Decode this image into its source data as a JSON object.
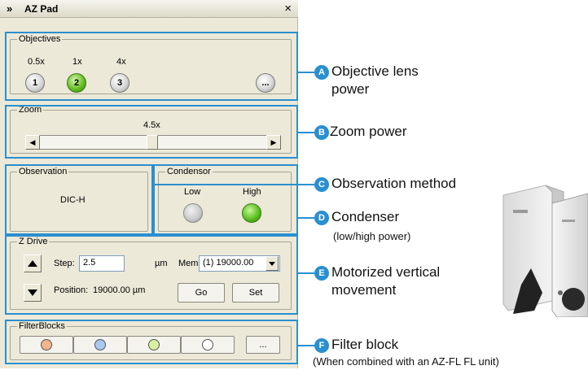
{
  "titlebar": {
    "chevron": "»",
    "title": "AZ Pad",
    "close": "×"
  },
  "objectives": {
    "legend": "Objectives",
    "magnifications": [
      "0.5x",
      "1x",
      "4x"
    ],
    "buttons": [
      "1",
      "2",
      "3"
    ],
    "active_button": "2",
    "more": "..."
  },
  "zoom": {
    "legend": "Zoom",
    "value": "4.5x",
    "left_arrow": "◀",
    "right_arrow": "▶"
  },
  "observation": {
    "legend": "Observation",
    "value": "DIC-H"
  },
  "condensor": {
    "legend": "Condensor",
    "low_label": "Low",
    "high_label": "High",
    "active": "High"
  },
  "z_drive": {
    "legend": "Z Drive",
    "step_label": "Step:",
    "step_value": "2.5",
    "step_unit": "µm",
    "mem_label": "Mem:",
    "mem_value": "(1) 19000.00",
    "position_label": "Position:",
    "position_value": "19000.00 µm",
    "go_label": "Go",
    "set_label": "Set"
  },
  "filterblocks": {
    "legend": "FilterBlocks",
    "colors": [
      "#f4b48c",
      "#a8c8f0",
      "#d8f0a0",
      "#ffffff"
    ],
    "more": "..."
  },
  "callouts": [
    {
      "badge": "A",
      "line1": "Objective lens",
      "line2": "power"
    },
    {
      "badge": "B",
      "line1": "Zoom power"
    },
    {
      "badge": "C",
      "line1": "Observation method"
    },
    {
      "badge": "D",
      "line1": "Condenser",
      "line2": "(low/high power)"
    },
    {
      "badge": "E",
      "line1": "Motorized vertical",
      "line2": "movement"
    },
    {
      "badge": "F",
      "line1": "Filter block",
      "line2": "(When combined with an AZ-FL FL unit)"
    }
  ],
  "colors": {
    "highlight": "#2a8fd0",
    "active_green": "#5cc220"
  },
  "icons": {
    "chevron": "double-chevron-right-icon",
    "close": "close-icon",
    "up": "arrow-up-icon",
    "down": "arrow-down-icon",
    "dropdown": "chevron-down-icon"
  }
}
